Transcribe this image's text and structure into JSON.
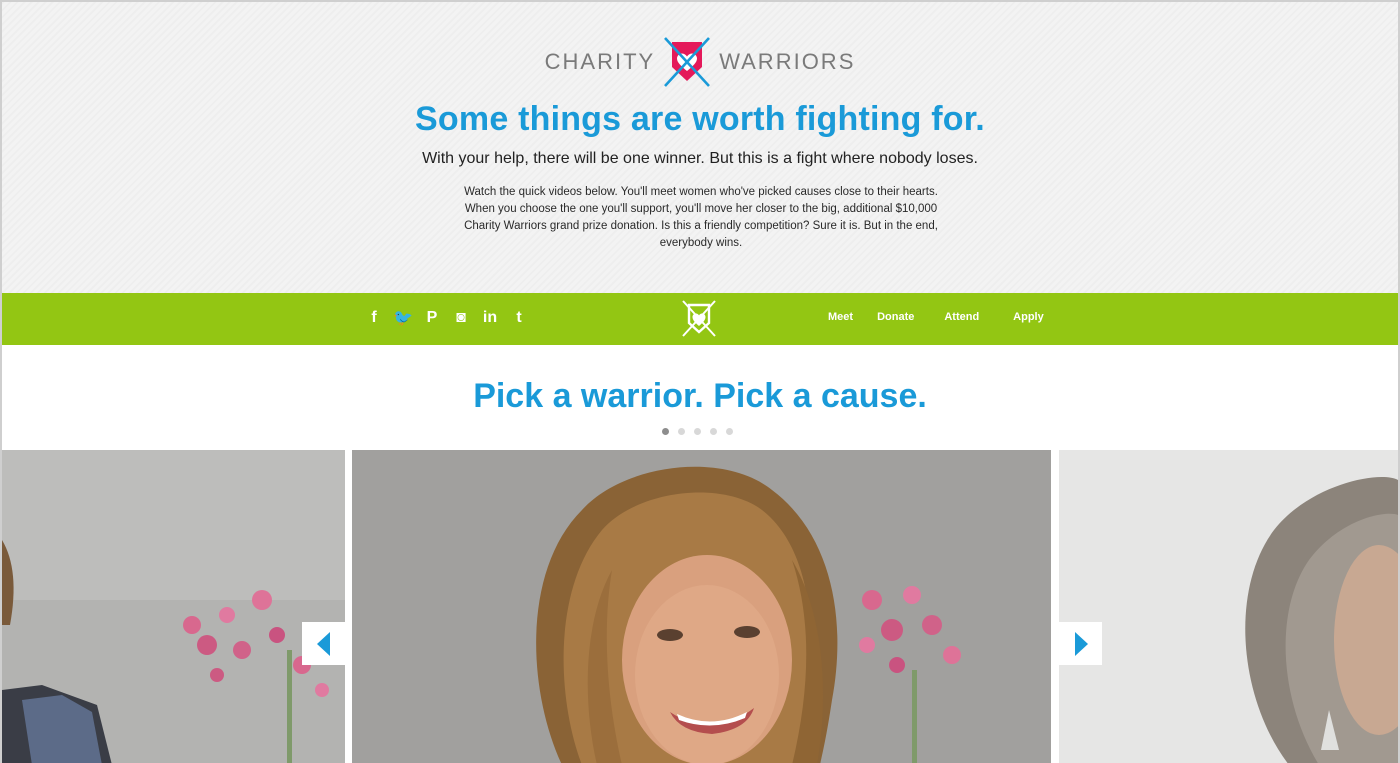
{
  "brand": {
    "word_left": "CHARITY",
    "word_right": "WARRIORS",
    "colors": {
      "blue": "#1a9ad8",
      "pink": "#e4195a",
      "green": "#93c613"
    }
  },
  "hero": {
    "headline": "Some things are worth fighting for.",
    "subhead": "With your help, there will be one winner. But this is a fight where nobody loses.",
    "intro": "Watch the quick videos below. You'll meet women who've picked causes close to their hearts. When you choose the one you'll support, you'll move her closer to the big, additional $10,000 Charity Warriors grand prize donation. Is this a friendly competition? Sure it is. But in the end, everybody wins."
  },
  "nav": {
    "social": [
      {
        "icon": "facebook-icon",
        "glyph": "f"
      },
      {
        "icon": "twitter-icon",
        "glyph": "🐦"
      },
      {
        "icon": "pinterest-icon",
        "glyph": "P"
      },
      {
        "icon": "instagram-icon",
        "glyph": "◙"
      },
      {
        "icon": "linkedin-icon",
        "glyph": "in"
      },
      {
        "icon": "tumblr-icon",
        "glyph": "t"
      }
    ],
    "menu": [
      "Meet",
      "Donate",
      "Attend",
      "Apply"
    ]
  },
  "pick": {
    "title": "Pick a warrior. Pick a cause.",
    "slide_count": 5,
    "active_index": 0
  }
}
